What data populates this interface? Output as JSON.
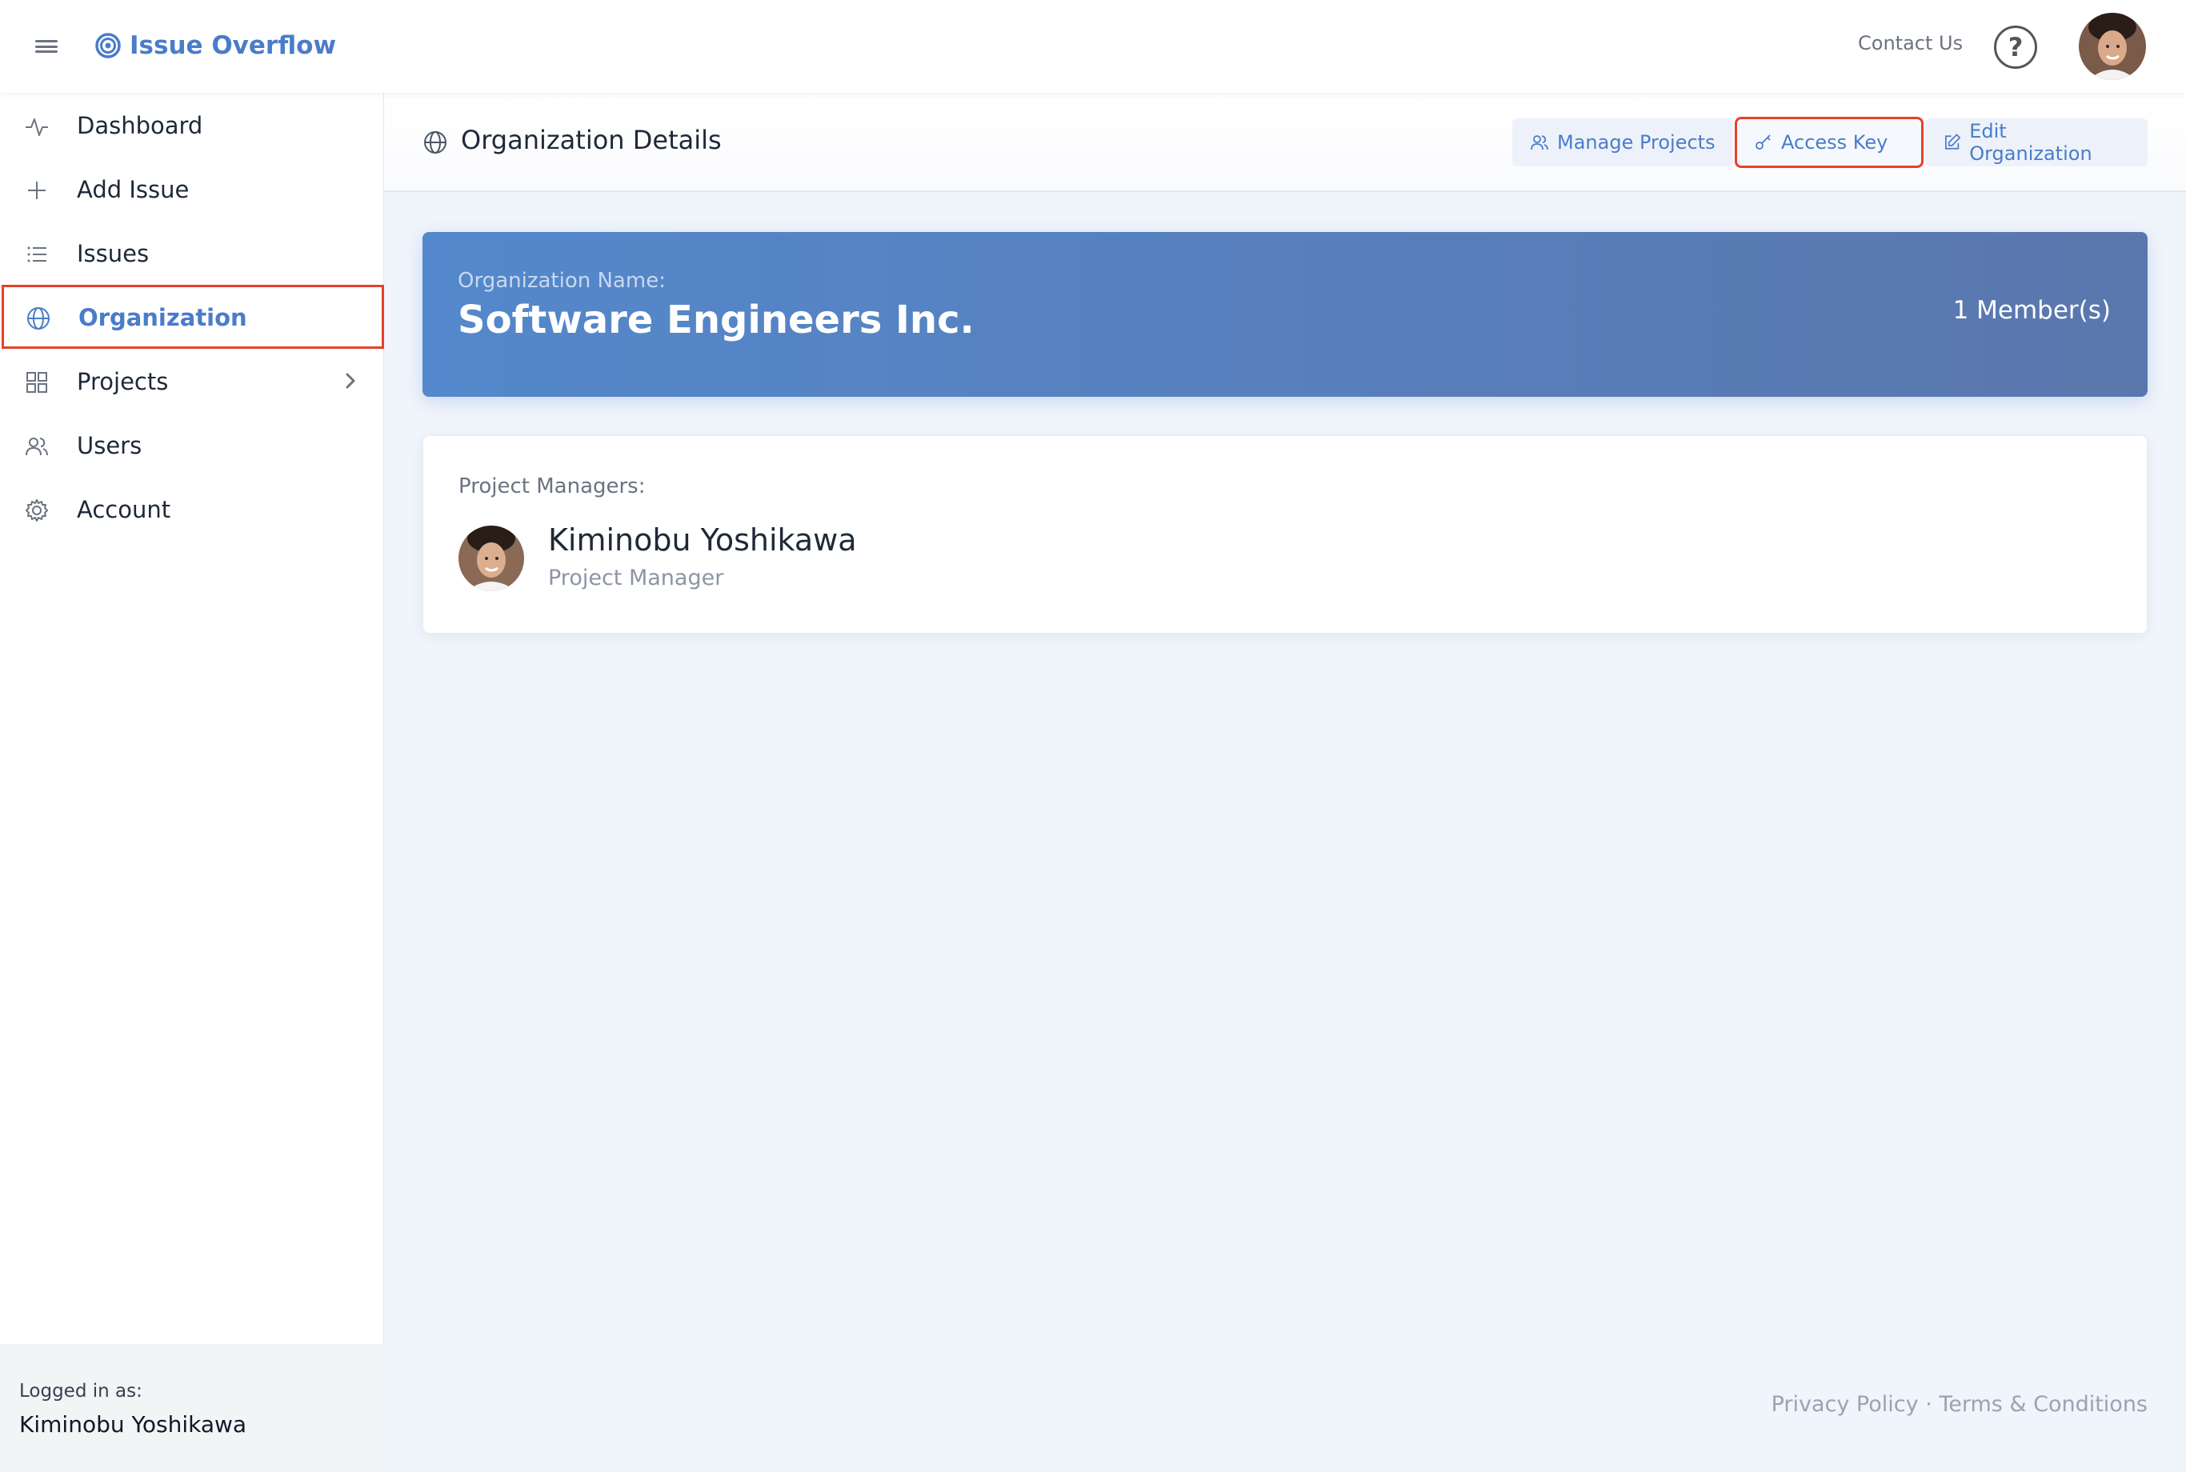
{
  "app": {
    "brand": "Issue Overflow",
    "contact_label": "Contact Us",
    "help_glyph": "?"
  },
  "sidebar": {
    "items": [
      {
        "label": "Dashboard",
        "icon": "activity-icon"
      },
      {
        "label": "Add Issue",
        "icon": "plus-icon"
      },
      {
        "label": "Issues",
        "icon": "list-icon"
      },
      {
        "label": "Organization",
        "icon": "globe-icon",
        "active": true
      },
      {
        "label": "Projects",
        "icon": "grid-icon"
      },
      {
        "label": "Users",
        "icon": "users-icon"
      },
      {
        "label": "Account",
        "icon": "gear-icon"
      }
    ],
    "logged_in_caption": "Logged in as:",
    "logged_in_name": "Kiminobu Yoshikawa"
  },
  "page_header": {
    "title": "Organization Details",
    "buttons": {
      "manage_projects": "Manage Projects",
      "access_key": "Access Key",
      "edit_organization": "Edit Organization"
    }
  },
  "organization": {
    "name_caption": "Organization Name:",
    "name": "Software Engineers Inc.",
    "members": "1 Member(s)"
  },
  "project_managers": {
    "caption": "Project Managers:",
    "list": [
      {
        "name": "Kiminobu Yoshikawa",
        "role": "Project Manager"
      }
    ]
  },
  "footer": {
    "privacy": "Privacy Policy",
    "separator": " · ",
    "terms": "Terms & Conditions"
  },
  "colors": {
    "accent": "#4a7cc9",
    "highlight_outline": "#e8402a",
    "banner_start": "#5488cc",
    "banner_end": "#5a77ad"
  }
}
